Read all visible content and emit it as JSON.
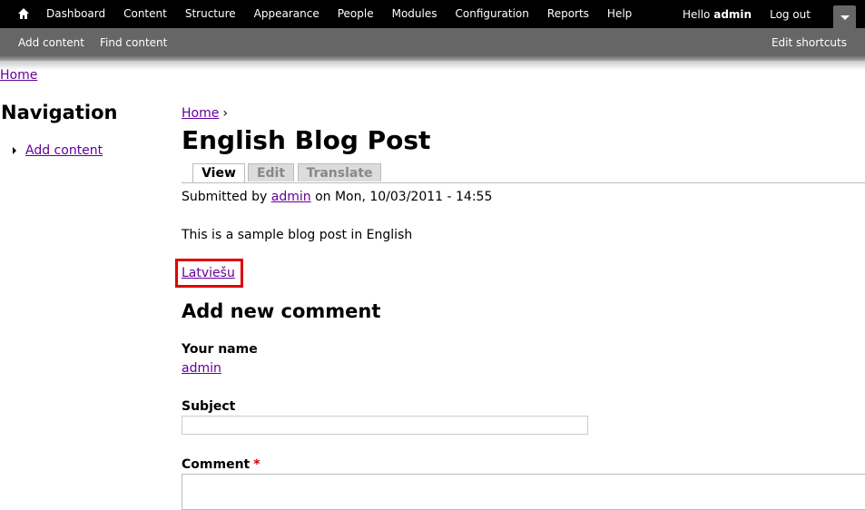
{
  "toolbar": {
    "menu": [
      "Dashboard",
      "Content",
      "Structure",
      "Appearance",
      "People",
      "Modules",
      "Configuration",
      "Reports",
      "Help"
    ],
    "hello_prefix": "Hello",
    "username": "admin",
    "logout": "Log out"
  },
  "shortcuts": {
    "links": [
      "Add content",
      "Find content"
    ],
    "edit": "Edit shortcuts"
  },
  "top_breadcrumb": "Home",
  "sidebar": {
    "title": "Navigation",
    "items": [
      "Add content"
    ]
  },
  "main": {
    "breadcrumb_home": "Home",
    "breadcrumb_sep": "›",
    "title": "English Blog Post",
    "tabs": [
      "View",
      "Edit",
      "Translate"
    ],
    "submitted_prefix": "Submitted by",
    "author": "admin",
    "submitted_suffix": "on Mon, 10/03/2011 - 14:55",
    "body": "This is a sample blog post in English",
    "language_link": "Latviešu"
  },
  "comment_form": {
    "title": "Add new comment",
    "name_label": "Your name",
    "name_value": "admin",
    "subject_label": "Subject",
    "subject_value": "",
    "comment_label": "Comment",
    "required_mark": "*"
  },
  "colors": {
    "toolbar_bg": "#000000",
    "shortcuts_bg": "#666666",
    "link": "#660099",
    "highlight": "#e00000",
    "required": "#cc0000"
  }
}
